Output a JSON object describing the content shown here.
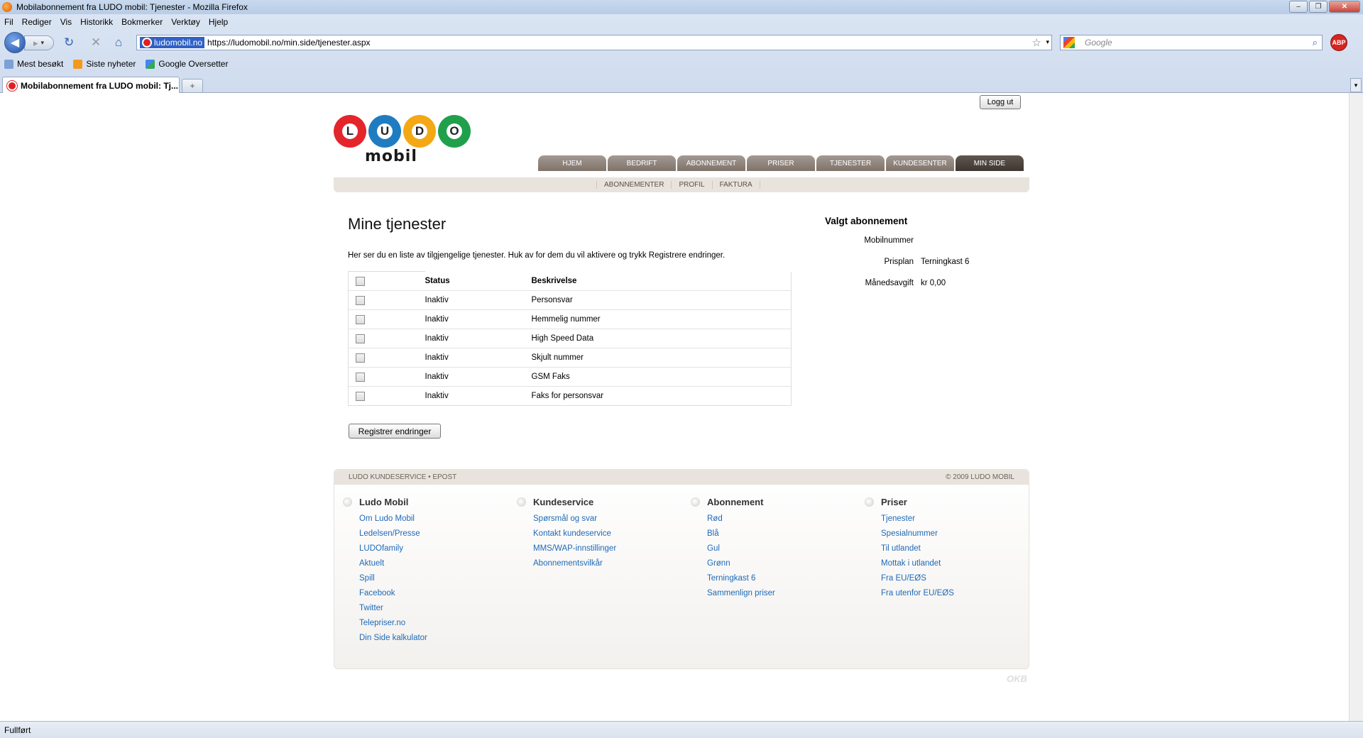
{
  "window": {
    "title": "Mobilabonnement fra LUDO mobil: Tjenester - Mozilla Firefox"
  },
  "menu": [
    "Fil",
    "Rediger",
    "Vis",
    "Historikk",
    "Bokmerker",
    "Verktøy",
    "Hjelp"
  ],
  "navigation": {
    "site_identity": "ludomobil.no",
    "url": "https://ludomobil.no/min.side/tjenester.aspx",
    "search_placeholder": "Google",
    "abp_label": "ABP"
  },
  "bookmarks": [
    "Mest besøkt",
    "Siste nyheter",
    "Google Oversetter"
  ],
  "tab": {
    "title": "Mobilabonnement fra LUDO mobil: Tj..."
  },
  "status": "Fullført",
  "page": {
    "logout": "Logg ut",
    "logo": {
      "letters": [
        "L",
        "U",
        "D",
        "O"
      ],
      "word": "mobil",
      "colors": [
        "#e3262b",
        "#1f7cc1",
        "#f4a815",
        "#20a04b"
      ]
    },
    "main_nav": [
      "HJEM",
      "BEDRIFT",
      "ABONNEMENT",
      "PRISER",
      "TJENESTER",
      "KUNDESENTER",
      "MIN SIDE"
    ],
    "main_nav_active": "MIN SIDE",
    "sub_nav": [
      "ABONNEMENTER",
      "PROFIL",
      "FAKTURA"
    ],
    "heading": "Mine tjenester",
    "intro": "Her ser du en liste av tilgjengelige tjenester. Huk av for dem du vil aktivere og trykk Registrere endringer.",
    "table": {
      "headers": [
        "Status",
        "Beskrivelse"
      ],
      "rows": [
        {
          "status": "Inaktiv",
          "description": "Personsvar",
          "checked": false
        },
        {
          "status": "Inaktiv",
          "description": "Hemmelig nummer",
          "checked": false
        },
        {
          "status": "Inaktiv",
          "description": "High Speed Data",
          "checked": false
        },
        {
          "status": "Inaktiv",
          "description": "Skjult nummer",
          "checked": false
        },
        {
          "status": "Inaktiv",
          "description": "GSM Faks",
          "checked": false
        },
        {
          "status": "Inaktiv",
          "description": "Faks for personsvar",
          "checked": false
        }
      ]
    },
    "register_button": "Registrer endringer",
    "subscription": {
      "heading": "Valgt abonnement",
      "rows": [
        {
          "label": "Mobilnummer",
          "value": ""
        },
        {
          "label": "Prisplan",
          "value": "Terningkast 6"
        },
        {
          "label": "Månedsavgift",
          "value": "kr 0,00"
        }
      ]
    },
    "footer": {
      "left": "LUDO KUNDESERVICE • EPOST",
      "right": "© 2009 LUDO MOBIL",
      "columns": [
        {
          "title": "Ludo Mobil",
          "links": [
            "Om Ludo Mobil",
            "Ledelsen/Presse",
            "LUDOfamily",
            "Aktuelt",
            "Spill",
            "Facebook",
            "Twitter",
            "Telepriser.no",
            "Din Side kalkulator"
          ]
        },
        {
          "title": "Kundeservice",
          "links": [
            "Spørsmål og svar",
            "Kontakt kundeservice",
            "MMS/WAP-innstillinger",
            "Abonnementsvilkår"
          ]
        },
        {
          "title": "Abonnement",
          "links": [
            "Rød",
            "Blå",
            "Gul",
            "Grønn",
            "Terningkast 6",
            "Sammenlign priser"
          ]
        },
        {
          "title": "Priser",
          "links": [
            "Tjenester",
            "Spesialnummer",
            "Til utlandet",
            "Mottak i utlandet",
            "Fra EU/EØS",
            "Fra utenfor EU/EØS"
          ]
        }
      ],
      "credit": "OKB"
    }
  }
}
